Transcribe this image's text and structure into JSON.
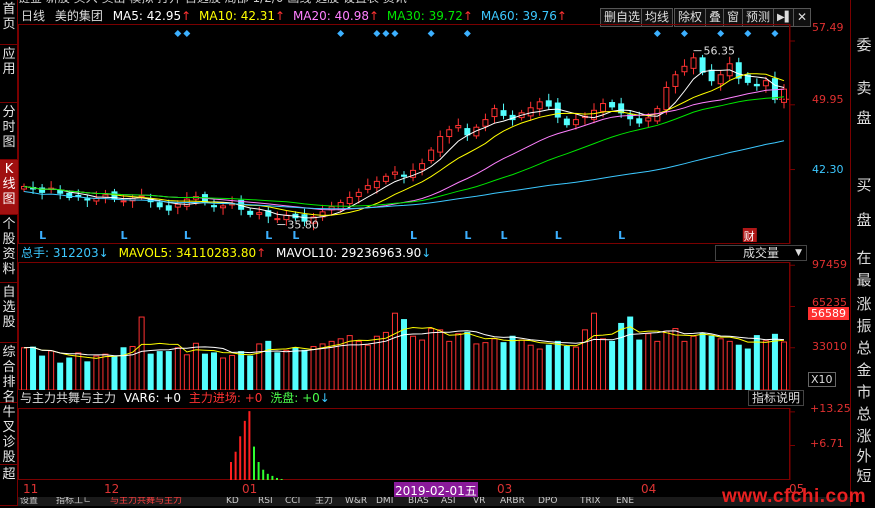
{
  "topline_partial": "     链金   新股    买入  卖出   模拟  打开   自选股    局部   1/2/0    画线   选股    设置表   资讯",
  "header": {
    "period": "日线",
    "stock": "美的集团",
    "ma5": "MA5: 42.95",
    "ma10": "MA10: 42.31",
    "ma20": "MA20: 40.98",
    "ma30": "MA30: 39.72",
    "ma60": "MA60: 39.76",
    "arrow_up": "↑"
  },
  "toolbar": {
    "delete_watch": "删自选",
    "avg_line": "均线",
    "rights": "除权",
    "overlay": "叠",
    "window": "窗",
    "forecast": "预测",
    "arrow": "▶▌",
    "close": "✕"
  },
  "sidebar": [
    {
      "label": "首页",
      "active": false
    },
    {
      "label": "应用",
      "active": false
    },
    {
      "label": "分时图",
      "active": false
    },
    {
      "label": "K线图",
      "active": true
    },
    {
      "label": "个股资料",
      "active": false
    },
    {
      "label": "自选股",
      "active": false
    },
    {
      "label": "综合排名",
      "active": false
    },
    {
      "label": "牛叉诊股",
      "active": false
    },
    {
      "label": "超",
      "active": false
    }
  ],
  "right_panel": [
    "委",
    "卖",
    "盘",
    "买",
    "盘",
    "在",
    "最",
    "涨",
    "振",
    "总",
    "金",
    "市",
    "总",
    "涨",
    "外",
    "短"
  ],
  "price_axis": [
    "57.49",
    "49.95",
    "42.30"
  ],
  "price_marks": {
    "high": "56.35",
    "low": "35.80",
    "fin": "财",
    "l": "L"
  },
  "volume": {
    "title": "总手: 312203",
    "ma5": "MAVOL5: 34110283.80",
    "ma10": "MAVOL10: 29236963.90",
    "arrow_up": "↑",
    "arrow_down": "↓",
    "dropdown": "成交量",
    "axis": [
      "97459",
      "65235",
      "33010"
    ],
    "current": "56589",
    "unit": "X10"
  },
  "indicator": {
    "title": "与主力共舞与主力",
    "var6": "VAR6: +0",
    "enter": "主力进场: +0",
    "wash": "洗盘: +0",
    "arrow": "↓",
    "explain": "指标说明",
    "axis": [
      "+13.25",
      "+6.71"
    ]
  },
  "dates": {
    "m11": "11",
    "m12": "12",
    "m01": "01",
    "hl": "2019-02-01五",
    "m03": "03",
    "m04": "04",
    "m05": "05"
  },
  "bottom_tabs": [
    "设置",
    "指标工ㄴ",
    "与主力共舞与主力",
    "KD",
    "RSI",
    "CCI",
    "主力",
    "W&R",
    "DMI",
    "BIAS",
    "ASI",
    "VR",
    "ARBR",
    "DPO",
    "TRIX",
    "ENE"
  ],
  "watermark": "www.cfchi.com",
  "colors": {
    "up": "#ff3232",
    "down": "#54ffff",
    "ma5": "#ffffff",
    "ma10": "#ffff00",
    "ma20": "#ff80ff",
    "ma30": "#00e600",
    "ma60": "#3cc8ff",
    "grid": "#7a0000",
    "axisText": "#e03030"
  },
  "chart_data": [
    {
      "type": "candlestick",
      "title": "美的集团 日线",
      "yaxis_ticks": [
        57.49,
        49.95,
        42.3
      ],
      "ylim": [
        33.5,
        59.5
      ],
      "approx_closes": [
        40.3,
        40.0,
        39.6,
        40.1,
        39.5,
        39.0,
        39.2,
        38.7,
        38.9,
        39.3,
        38.8,
        38.6,
        38.9,
        39.2,
        38.5,
        37.9,
        37.5,
        38.2,
        38.8,
        39.1,
        38.4,
        37.9,
        38.0,
        38.3,
        37.6,
        37.0,
        37.2,
        36.8,
        36.5,
        36.9,
        36.6,
        36.2,
        36.7,
        37.3,
        37.9,
        38.4,
        39.0,
        39.6,
        40.4,
        40.9,
        41.5,
        42.0,
        41.5,
        42.2,
        43.0,
        44.6,
        46.2,
        47.0,
        47.5,
        46.4,
        47.3,
        48.2,
        49.5,
        48.7,
        48.2,
        49.0,
        49.6,
        50.3,
        49.8,
        48.5,
        47.6,
        48.2,
        48.6,
        49.3,
        50.1,
        49.7,
        49.0,
        48.3,
        47.8,
        48.4,
        49.5,
        52.0,
        53.5,
        54.5,
        55.5,
        53.8,
        52.8,
        53.5,
        54.8,
        53.1,
        52.6,
        52.2,
        52.8,
        50.6,
        51.8
      ]
    },
    {
      "type": "bar",
      "title": "成交量",
      "ylim": [
        0,
        100000
      ],
      "yaxis_ticks": [
        97459,
        65235,
        33010
      ],
      "approx_values": [
        33000,
        33500,
        26500,
        30500,
        21000,
        25000,
        29000,
        22000,
        26500,
        28000,
        26000,
        33000,
        34000,
        57000,
        28000,
        30000,
        30000,
        33000,
        27500,
        36500,
        28000,
        29000,
        25000,
        27000,
        30000,
        26500,
        36000,
        38000,
        29000,
        31000,
        33000,
        31000,
        34000,
        36000,
        38000,
        40000,
        42500,
        38000,
        35000,
        42000,
        45000,
        60000,
        55000,
        42000,
        39000,
        48000,
        47000,
        38000,
        44000,
        45000,
        36000,
        37000,
        40000,
        37000,
        42000,
        39000,
        35000,
        32000,
        35000,
        38000,
        34000,
        33500,
        47000,
        60000,
        40000,
        38000,
        52000,
        57000,
        39000,
        44000,
        38000,
        46000,
        48000,
        38000,
        42000,
        44500,
        42000,
        40000,
        38000,
        35000,
        32000,
        42500,
        38500,
        43500,
        37500
      ]
    },
    {
      "type": "bar",
      "title": "与主力共舞与主力",
      "ylim": [
        0,
        14
      ],
      "yaxis_ticks": [
        13.25,
        6.71
      ],
      "approx_values": [
        3.5,
        5.5,
        8.5,
        11.5,
        13.4,
        6.5,
        3.5,
        2.0,
        1.2,
        0.8,
        0.4,
        0.2
      ]
    }
  ]
}
